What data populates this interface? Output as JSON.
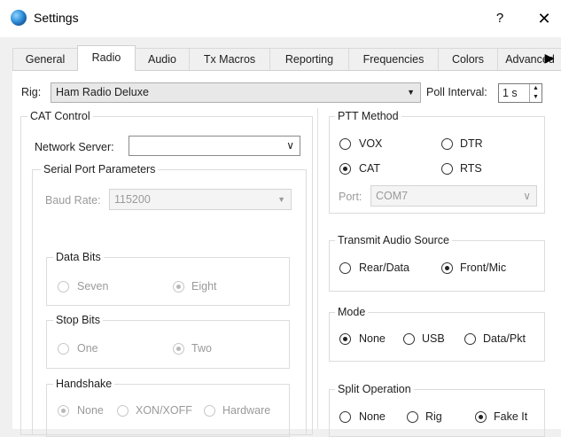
{
  "window": {
    "title": "Settings",
    "help_glyph": "?",
    "close_glyph": "✕"
  },
  "tabs": [
    {
      "label": "General",
      "active": false
    },
    {
      "label": "Radio",
      "active": true
    },
    {
      "label": "Audio",
      "active": false
    },
    {
      "label": "Tx Macros",
      "active": false
    },
    {
      "label": "Reporting",
      "active": false
    },
    {
      "label": "Frequencies",
      "active": false
    },
    {
      "label": "Colors",
      "active": false
    },
    {
      "label": "Advanced",
      "active": false
    }
  ],
  "tab_scroll_glyph": "▶",
  "rig": {
    "label": "Rig:",
    "value": "Ham Radio Deluxe",
    "arrow": "▼"
  },
  "poll": {
    "label": "Poll Interval:",
    "value": "1 s",
    "up": "▲",
    "down": "▼"
  },
  "cat": {
    "title": "CAT Control",
    "network_server_label": "Network Server:",
    "network_server_value": "",
    "network_arrow": "∨",
    "serial": {
      "title": "Serial Port Parameters",
      "baud_label": "Baud Rate:",
      "baud_value": "115200",
      "baud_arrow": "▼",
      "data_bits": {
        "title": "Data Bits",
        "options": [
          "Seven",
          "Eight"
        ],
        "selected": "Eight"
      },
      "stop_bits": {
        "title": "Stop Bits",
        "options": [
          "One",
          "Two"
        ],
        "selected": "Two"
      },
      "handshake": {
        "title": "Handshake",
        "options": [
          "None",
          "XON/XOFF",
          "Hardware"
        ],
        "selected": "None"
      }
    }
  },
  "ptt": {
    "title": "PTT Method",
    "options": [
      "VOX",
      "DTR",
      "CAT",
      "RTS"
    ],
    "selected": "CAT",
    "port_label": "Port:",
    "port_value": "COM7",
    "port_arrow": "∨"
  },
  "audio_source": {
    "title": "Transmit Audio Source",
    "options": [
      "Rear/Data",
      "Front/Mic"
    ],
    "selected": "Front/Mic"
  },
  "mode": {
    "title": "Mode",
    "options": [
      "None",
      "USB",
      "Data/Pkt"
    ],
    "selected": "None"
  },
  "split": {
    "title": "Split Operation",
    "options": [
      "None",
      "Rig",
      "Fake It"
    ],
    "selected": "Fake It"
  }
}
